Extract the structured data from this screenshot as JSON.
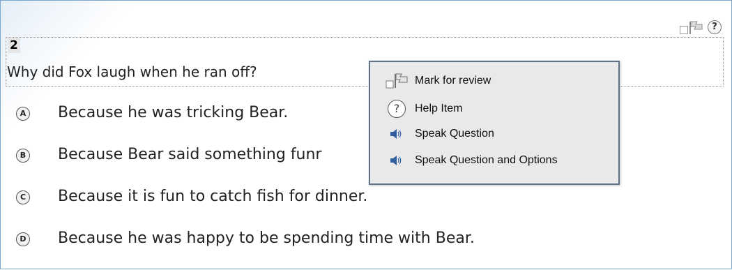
{
  "question": {
    "number": "2",
    "text": "Why did Fox laugh when he ran off?"
  },
  "toolbar": {
    "mark_icon": "flag-checkbox-icon",
    "help_icon": "help-icon",
    "help_glyph": "?"
  },
  "options": [
    {
      "letter": "A",
      "text": "Because he was tricking Bear."
    },
    {
      "letter": "B",
      "text": "Because Bear said something funr"
    },
    {
      "letter": "C",
      "text": "Because it is fun to catch fish for dinner."
    },
    {
      "letter": "D",
      "text": "Because he was happy to be spending time with Bear."
    }
  ],
  "context_menu": {
    "items": [
      {
        "label": "Mark for review",
        "icon": "flag-checkbox-icon"
      },
      {
        "label": "Help Item",
        "icon": "help-icon"
      },
      {
        "label": "Speak Question",
        "icon": "speaker-icon"
      },
      {
        "label": "Speak Question and Options",
        "icon": "speaker-icon"
      }
    ]
  },
  "help_menu_glyph": "?",
  "colors": {
    "frame_border": "#7aa7cf",
    "menu_bg": "#e9e9e9",
    "menu_border": "#5f6f86"
  }
}
